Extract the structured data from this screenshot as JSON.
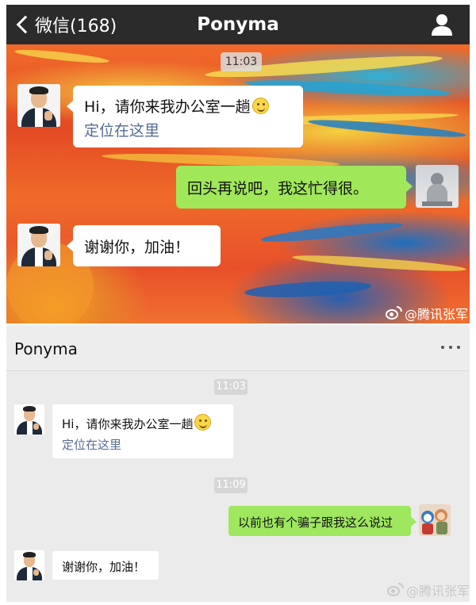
{
  "panel1": {
    "back_label": "微信(168)",
    "title": "Ponyma",
    "time": "11:03",
    "messages": {
      "m1_text": "Hi，请你来我办公室一趟",
      "m1_link": "定位在这里",
      "m2_text": "回头再说吧，我这忙得很。",
      "m3_text": "谢谢你，加油！"
    },
    "watermark": "@腾讯张军"
  },
  "panel2": {
    "title": "Ponyma",
    "time1": "11:03",
    "time2": "11:09",
    "messages": {
      "m1_text": "Hi，请你来我办公室一趟",
      "m1_link": "定位在这里",
      "m2_text": "以前也有个骗子跟我这么说过",
      "m3_text": "谢谢你，加油！"
    },
    "watermark": "@腾讯张军"
  },
  "icons": {
    "back": "chevron-left-icon",
    "user": "user-icon",
    "more": "more-dots-icon",
    "smile": "smile-emoji-icon",
    "weibo": "weibo-icon"
  },
  "colors": {
    "wechat_green_bubble": "#a0e75a",
    "link": "#576b95",
    "titlebar_dark": "#2b2b2b",
    "chat_bg_light": "#ebebeb"
  }
}
